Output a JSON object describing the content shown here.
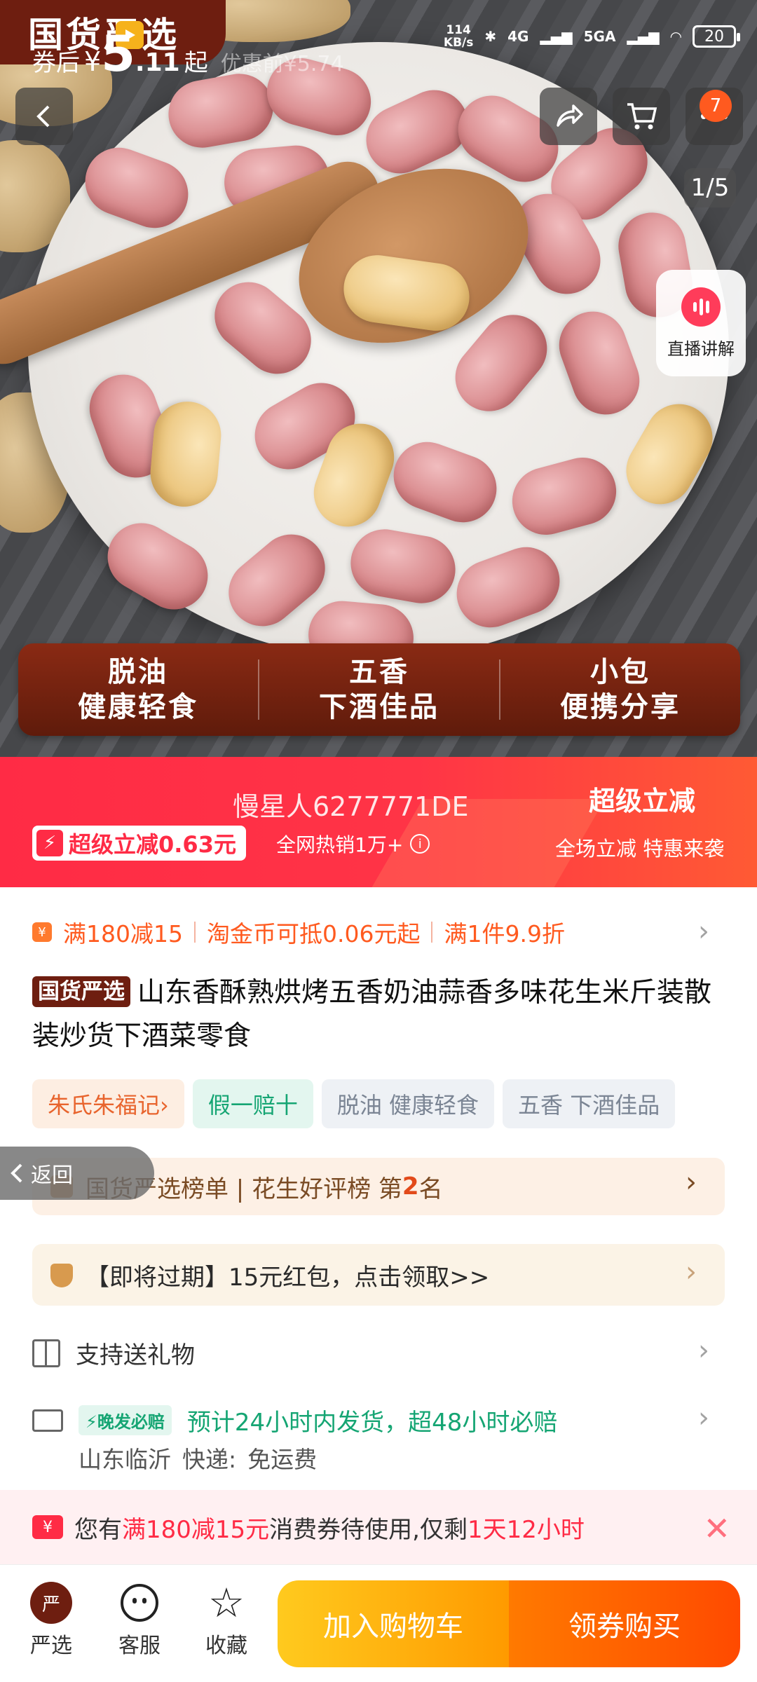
{
  "hero": {
    "brand_tag": "国货严选",
    "status": {
      "speed_top": "114",
      "speed_bottom": "KB/s",
      "net1": "4G",
      "net2": "5GA",
      "battery": "20"
    },
    "cart_badge": "7",
    "pager": "1/5",
    "live_label": "直播讲解",
    "banner": [
      {
        "line1": "脱油",
        "line2": "健康轻食"
      },
      {
        "line1": "五香",
        "line2": "下酒佳品"
      },
      {
        "line1": "小包",
        "line2": "便携分享"
      }
    ]
  },
  "price": {
    "prefix": "券后",
    "currency": "¥",
    "integer": "5",
    "decimal": ".11",
    "suffix": "起",
    "faint": "优惠前¥5.74",
    "watermark": "慢星人6277771DE",
    "super_pill": "超级立减0.63元",
    "hot_sales": "全网热销1万+",
    "right_title": "超级立减",
    "right_sub": "全场立减 特惠来袭"
  },
  "promo": {
    "items": [
      "满180减15",
      "淘金币可抵0.06元起",
      "满1件9.9折"
    ]
  },
  "title": {
    "tag": "国货严选",
    "text": "山东香酥熟烘烤五香奶油蒜香多味花生米斤装散装炒货下酒菜零食"
  },
  "tags": [
    "朱氏朱福记›",
    "假一赔十",
    "脱油 健康轻食",
    "五香 下酒佳品"
  ],
  "rank": {
    "prefix": "国货严选榜单 | 花生好评榜 第",
    "num": "2",
    "suffix": "名"
  },
  "back_label": "返回",
  "redpack": "【即将过期】15元红包，点击领取>>",
  "gift": "支持送礼物",
  "shipping": {
    "badge": "晚发必赔",
    "text": "预计24小时内发货，超48小时必赔",
    "origin": "山东临沂",
    "express_label": "快递:",
    "express_value": "免运费"
  },
  "notice": {
    "ticket": "¥",
    "p1": "您有",
    "hl1": "满180减15元",
    "p2": "消费券待使用,仅剩",
    "hl2": "1天12小时"
  },
  "bottom": {
    "nav": [
      "严选",
      "客服",
      "收藏"
    ],
    "logo_text": "严",
    "add_cart": "加入购物车",
    "buy": "领券购买"
  },
  "colors": {
    "accent_red": "#ff2b45",
    "brand_brown": "#6e1e10",
    "orange": "#ff5a1f",
    "green": "#15a573"
  }
}
